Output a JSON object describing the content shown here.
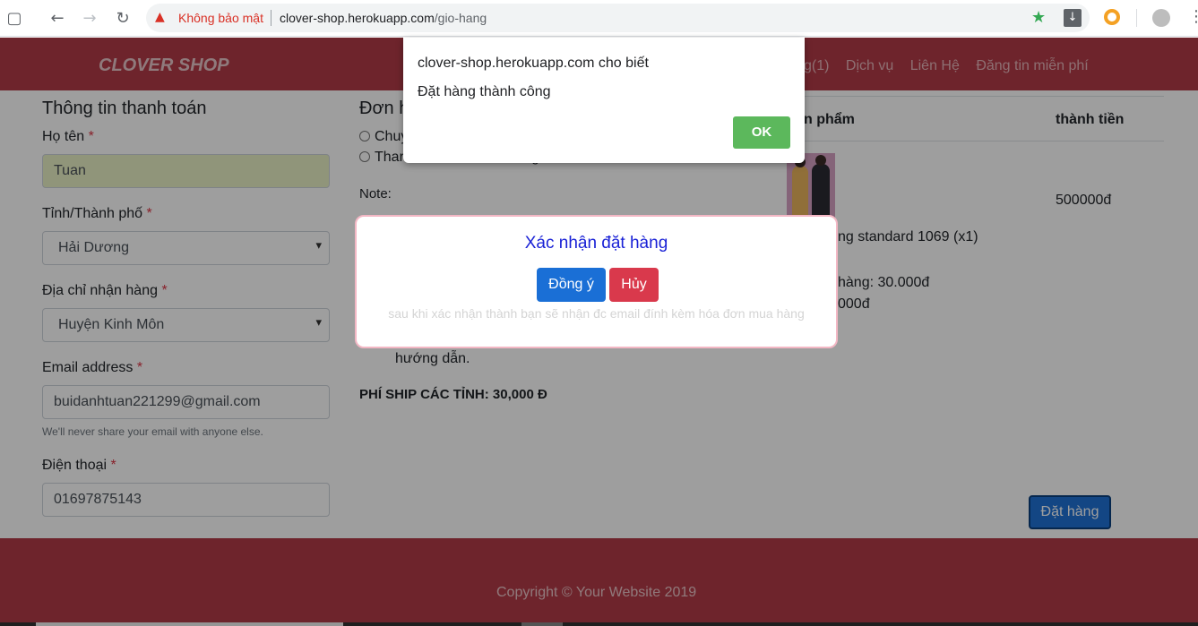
{
  "browser": {
    "security_label": "Không bảo mật",
    "url_host": "clover-shop.herokuapp.com",
    "url_path": "/gio-hang"
  },
  "header": {
    "brand": "CLOVER SHOP",
    "nav": [
      "g(1)",
      "Dịch vụ",
      "Liên Hệ",
      "Đăng tin miễn phí"
    ]
  },
  "billing": {
    "title": "Thông tin thanh toán",
    "name_label": "Họ tên",
    "name_value": "Tuan",
    "city_label": "Tỉnh/Thành phố",
    "city_value": "Hải Dương",
    "address_label": "Địa chỉ nhận hàng",
    "address_value": "Huyện Kinh Môn",
    "email_label": "Email address",
    "email_value": "buidanhtuan221299@gmail.com",
    "email_help": "We'll never share your email with anyone else.",
    "phone_label": "Điện thoại",
    "phone_value": "01697875143",
    "required_mark": "*"
  },
  "order": {
    "title": "Đơn h",
    "option1": "Chuy",
    "option2": "Thar",
    "option2_tail": "g",
    "note_label": "Note:",
    "guide_tail": "hướng dẫn.",
    "ship_fee": "PHÍ SHIP CÁC TỈNH: 30,000 Đ"
  },
  "cart": {
    "col_product": "n phẩm",
    "col_total": "thành tiền",
    "item_price": "500000đ",
    "item_name": "ng standard 1069 (x1)",
    "ship_line": "hàng: 30.000đ",
    "total_line": "000đ",
    "order_button": "Đặt hàng"
  },
  "footer": {
    "copyright": "Copyright © Your Website 2019"
  },
  "confirm_modal": {
    "title": "Xác nhận đặt hàng",
    "agree": "Đồng ý",
    "cancel": "Hủy",
    "subtitle": "sau khi xác nhận thành bạn sẽ nhận đc email đính kèm hóa đơn mua hàng"
  },
  "alert": {
    "origin": "clover-shop.herokuapp.com cho biết",
    "message": "Đặt hàng thành công",
    "ok": "OK"
  },
  "icons": {
    "back": "arrow-left-icon",
    "forward": "arrow-right-icon",
    "reload": "reload-icon",
    "warning": "warning-triangle-icon",
    "bookmark": "star-icon",
    "download": "download-icon"
  },
  "colors": {
    "header_bg": "#b23b47",
    "alert_ok": "#5cb85c",
    "confirm_agree": "#1a6fd6",
    "confirm_cancel": "#d9394c"
  }
}
